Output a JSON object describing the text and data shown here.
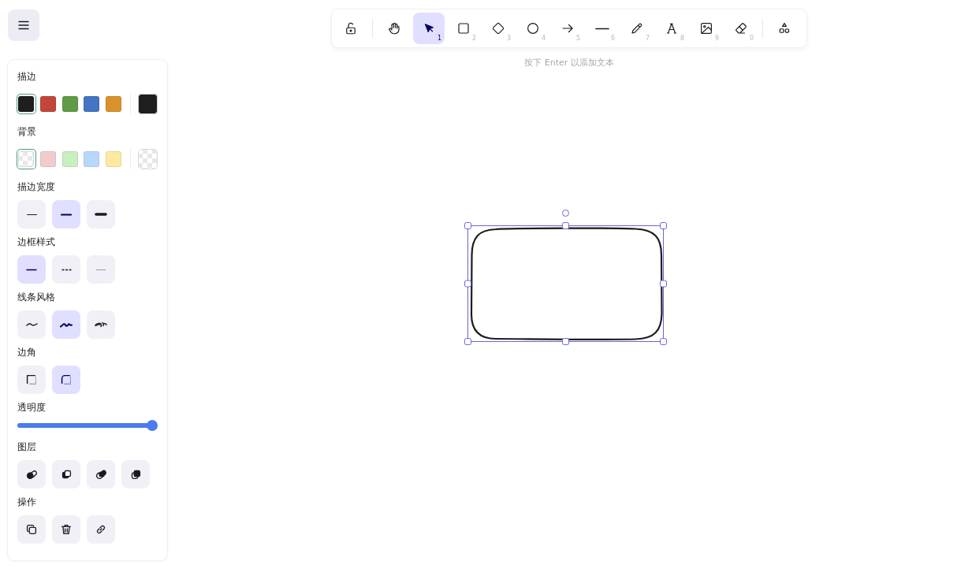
{
  "menu_button": {
    "kind": "menu"
  },
  "toolbar": {
    "groups": [
      [
        {
          "kind": "lock",
          "selected": false
        }
      ],
      [
        {
          "kind": "hand",
          "selected": false
        },
        {
          "kind": "select",
          "key": "1",
          "selected": true
        },
        {
          "kind": "rectangle",
          "key": "2",
          "selected": false
        },
        {
          "kind": "diamond",
          "key": "3",
          "selected": false
        },
        {
          "kind": "ellipse",
          "key": "4",
          "selected": false
        },
        {
          "kind": "arrow",
          "key": "5",
          "selected": false
        },
        {
          "kind": "line",
          "key": "6",
          "selected": false
        },
        {
          "kind": "pencil",
          "key": "7",
          "selected": false
        },
        {
          "kind": "text",
          "key": "8",
          "selected": false
        },
        {
          "kind": "image",
          "key": "9",
          "selected": false
        },
        {
          "kind": "eraser",
          "key": "0",
          "selected": false
        }
      ],
      [
        {
          "kind": "shapes",
          "selected": false
        }
      ]
    ]
  },
  "hint": "按下 Enter 以添加文本",
  "panel": {
    "sections": [
      {
        "title": "描边",
        "kind": "swatches",
        "swatches": [
          {
            "color": "#1e1e1e",
            "selected": true
          },
          {
            "color": "#c2473a",
            "selected": false
          },
          {
            "color": "#619b47",
            "selected": false
          },
          {
            "color": "#4474c2",
            "selected": false
          },
          {
            "color": "#d8912b",
            "selected": false
          }
        ],
        "current": {
          "color": "#1e1e1e"
        }
      },
      {
        "title": "背景",
        "kind": "swatches",
        "swatches": [
          {
            "kind": "transparent",
            "selected": true
          },
          {
            "color": "#f0cdcc",
            "selected": false
          },
          {
            "color": "#c9eec0",
            "selected": false
          },
          {
            "color": "#b8d8fb",
            "selected": false
          },
          {
            "color": "#fbeaa0",
            "selected": false
          }
        ],
        "current": {
          "kind": "transparent"
        }
      },
      {
        "title": "描边宽度",
        "kind": "options",
        "options": [
          {
            "kind": "width-thin",
            "selected": false
          },
          {
            "kind": "width-bold",
            "selected": true
          },
          {
            "kind": "width-extra-bold",
            "selected": false
          }
        ]
      },
      {
        "title": "边框样式",
        "kind": "options",
        "options": [
          {
            "kind": "solid",
            "selected": true
          },
          {
            "kind": "dashed",
            "selected": false
          },
          {
            "kind": "dotted",
            "selected": false
          }
        ]
      },
      {
        "title": "线条风格",
        "kind": "options",
        "options": [
          {
            "kind": "architect",
            "selected": false
          },
          {
            "kind": "artist",
            "selected": true
          },
          {
            "kind": "cartoonist",
            "selected": false
          }
        ]
      },
      {
        "title": "边角",
        "kind": "options",
        "options": [
          {
            "kind": "sharp",
            "selected": false
          },
          {
            "kind": "round",
            "selected": true
          }
        ]
      },
      {
        "title": "透明度",
        "kind": "slider",
        "level": 1
      },
      {
        "title": "图层",
        "kind": "buttons",
        "options": [
          {
            "kind": "send-to-back"
          },
          {
            "kind": "send-backward"
          },
          {
            "kind": "bring-forward"
          },
          {
            "kind": "bring-to-front"
          }
        ]
      },
      {
        "title": "操作",
        "kind": "buttons",
        "options": [
          {
            "kind": "duplicate"
          },
          {
            "kind": "delete"
          },
          {
            "kind": "link"
          }
        ]
      }
    ]
  },
  "canvas": {
    "shapes": [
      {
        "kind": "rounded-rectangle",
        "selected": true
      }
    ]
  }
}
